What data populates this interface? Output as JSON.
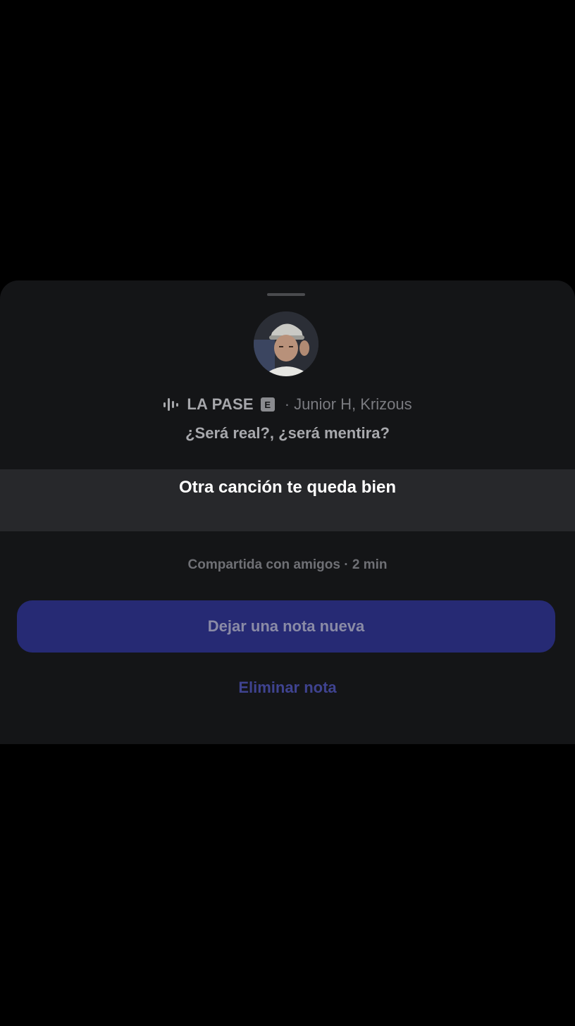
{
  "sheet": {
    "track": {
      "title": "LA PASE",
      "explicit_badge": "E",
      "separator": "·",
      "artists": "Junior H, Krizous",
      "playing_icon": "equalizer-icon"
    },
    "lyric": "¿Será real?, ¿será mentira?",
    "note": "Otra canción te queda bien",
    "meta": "Compartida con amigos · 2 min",
    "primary_button_label": "Dejar una nota nueva",
    "delete_link_label": "Eliminar nota"
  },
  "colors": {
    "background": "#000000",
    "sheet": "#141517",
    "note_band": "#27282b",
    "primary_button": "#262a74",
    "delete_link": "#3f4390"
  }
}
